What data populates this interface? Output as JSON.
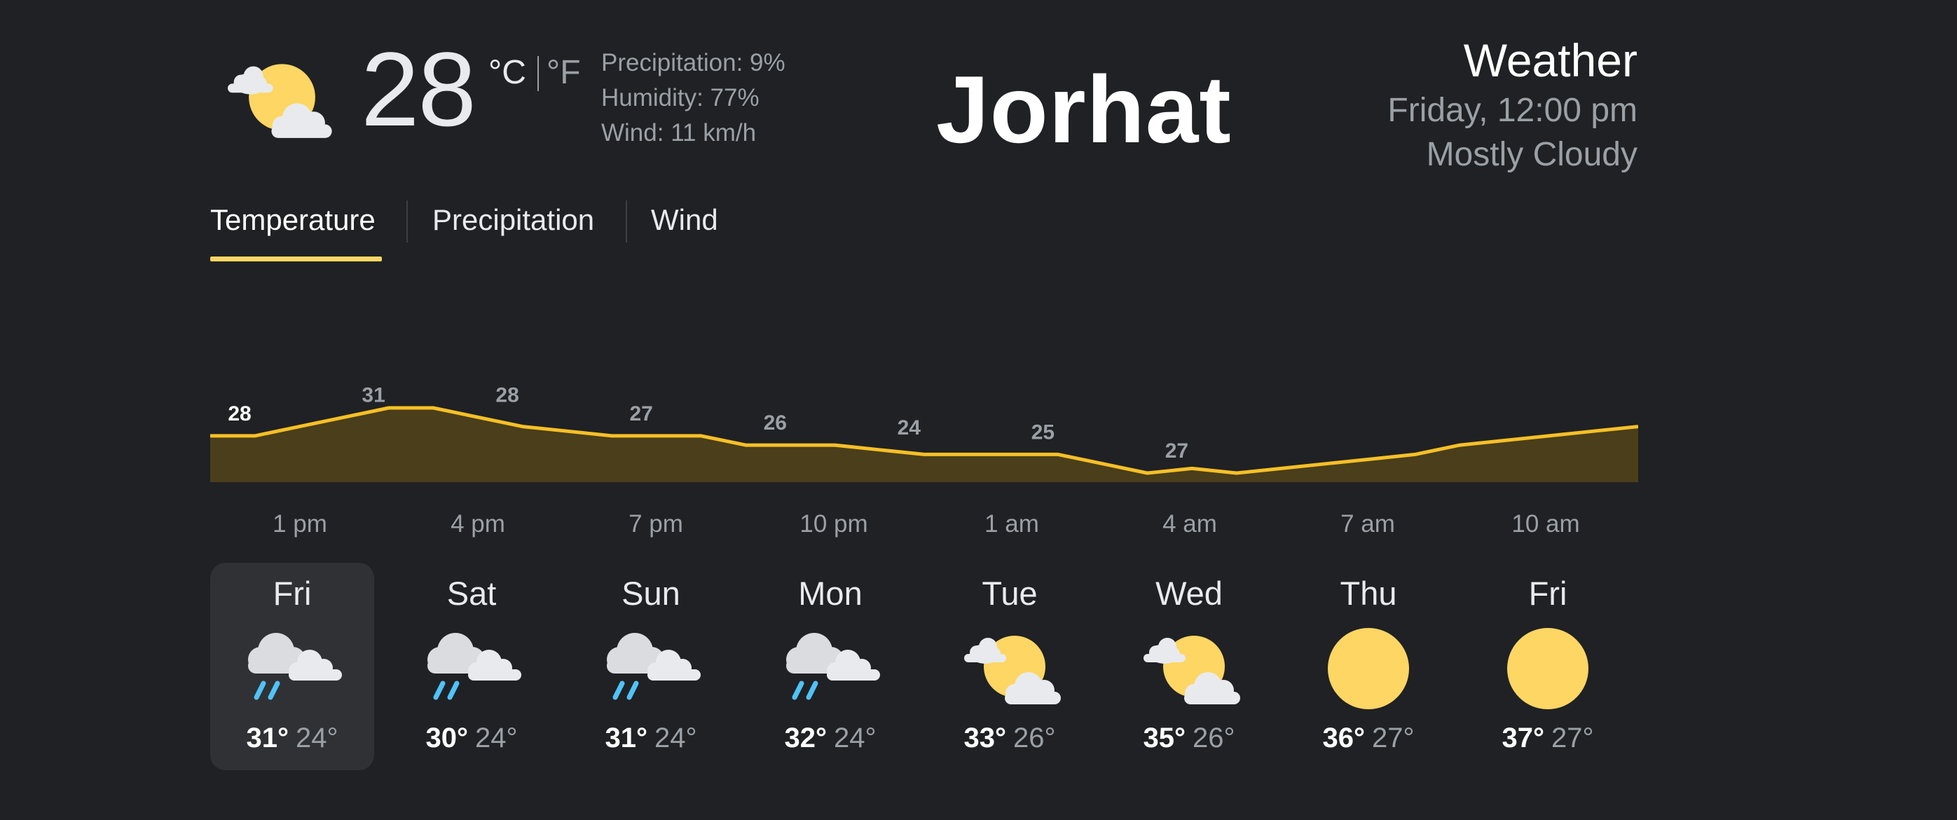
{
  "current": {
    "temp": "28",
    "unit_c": "°C",
    "unit_f": "°F",
    "precipitation": "Precipitation: 9%",
    "humidity": "Humidity: 77%",
    "wind": "Wind: 11 km/h",
    "icon": "partly-cloudy-icon"
  },
  "location": {
    "city": "Jorhat"
  },
  "summary": {
    "title": "Weather",
    "datetime": "Friday, 12:00 pm",
    "condition": "Mostly Cloudy"
  },
  "tabs": [
    {
      "label": "Temperature",
      "selected": true
    },
    {
      "label": "Precipitation",
      "selected": false
    },
    {
      "label": "Wind",
      "selected": false
    }
  ],
  "colors": {
    "accent": "#fdd663",
    "chart_line": "#f6c026",
    "chart_fill": "#4a3e1b",
    "background": "#202124",
    "selected_day": "#303134"
  },
  "chart_data": {
    "type": "area",
    "series": [
      {
        "values": [
          28,
          28,
          29,
          30,
          31,
          31,
          30,
          29,
          28.5,
          28,
          28,
          28,
          27,
          27,
          27,
          26.5,
          26,
          26,
          26,
          26,
          25,
          24,
          24.5,
          24,
          24.5,
          25,
          25.5,
          26,
          27,
          27.5,
          28,
          28.5,
          29
        ]
      }
    ],
    "data_labels": [
      {
        "index": 0,
        "text": "28"
      },
      {
        "index": 3,
        "text": "31"
      },
      {
        "index": 6,
        "text": "28"
      },
      {
        "index": 9,
        "text": "27"
      },
      {
        "index": 12,
        "text": "26"
      },
      {
        "index": 15,
        "text": "24"
      },
      {
        "index": 18,
        "text": "25"
      },
      {
        "index": 21,
        "text": "27"
      }
    ],
    "hour_labels": [
      "1 pm",
      "4 pm",
      "7 pm",
      "10 pm",
      "1 am",
      "4 am",
      "7 am",
      "10 am"
    ],
    "ylim": [
      20,
      34
    ],
    "grid": false
  },
  "forecast": [
    {
      "day": "Fri",
      "high": "31°",
      "low": "24°",
      "icon": "rain-cloudy-icon",
      "selected": true
    },
    {
      "day": "Sat",
      "high": "30°",
      "low": "24°",
      "icon": "rain-cloudy-icon",
      "selected": false
    },
    {
      "day": "Sun",
      "high": "31°",
      "low": "24°",
      "icon": "rain-cloudy-icon",
      "selected": false
    },
    {
      "day": "Mon",
      "high": "32°",
      "low": "24°",
      "icon": "rain-cloudy-icon",
      "selected": false
    },
    {
      "day": "Tue",
      "high": "33°",
      "low": "26°",
      "icon": "partly-cloudy-icon",
      "selected": false
    },
    {
      "day": "Wed",
      "high": "35°",
      "low": "26°",
      "icon": "partly-cloudy-icon",
      "selected": false
    },
    {
      "day": "Thu",
      "high": "36°",
      "low": "27°",
      "icon": "sunny-icon",
      "selected": false
    },
    {
      "day": "Fri",
      "high": "37°",
      "low": "27°",
      "icon": "sunny-icon",
      "selected": false
    }
  ]
}
